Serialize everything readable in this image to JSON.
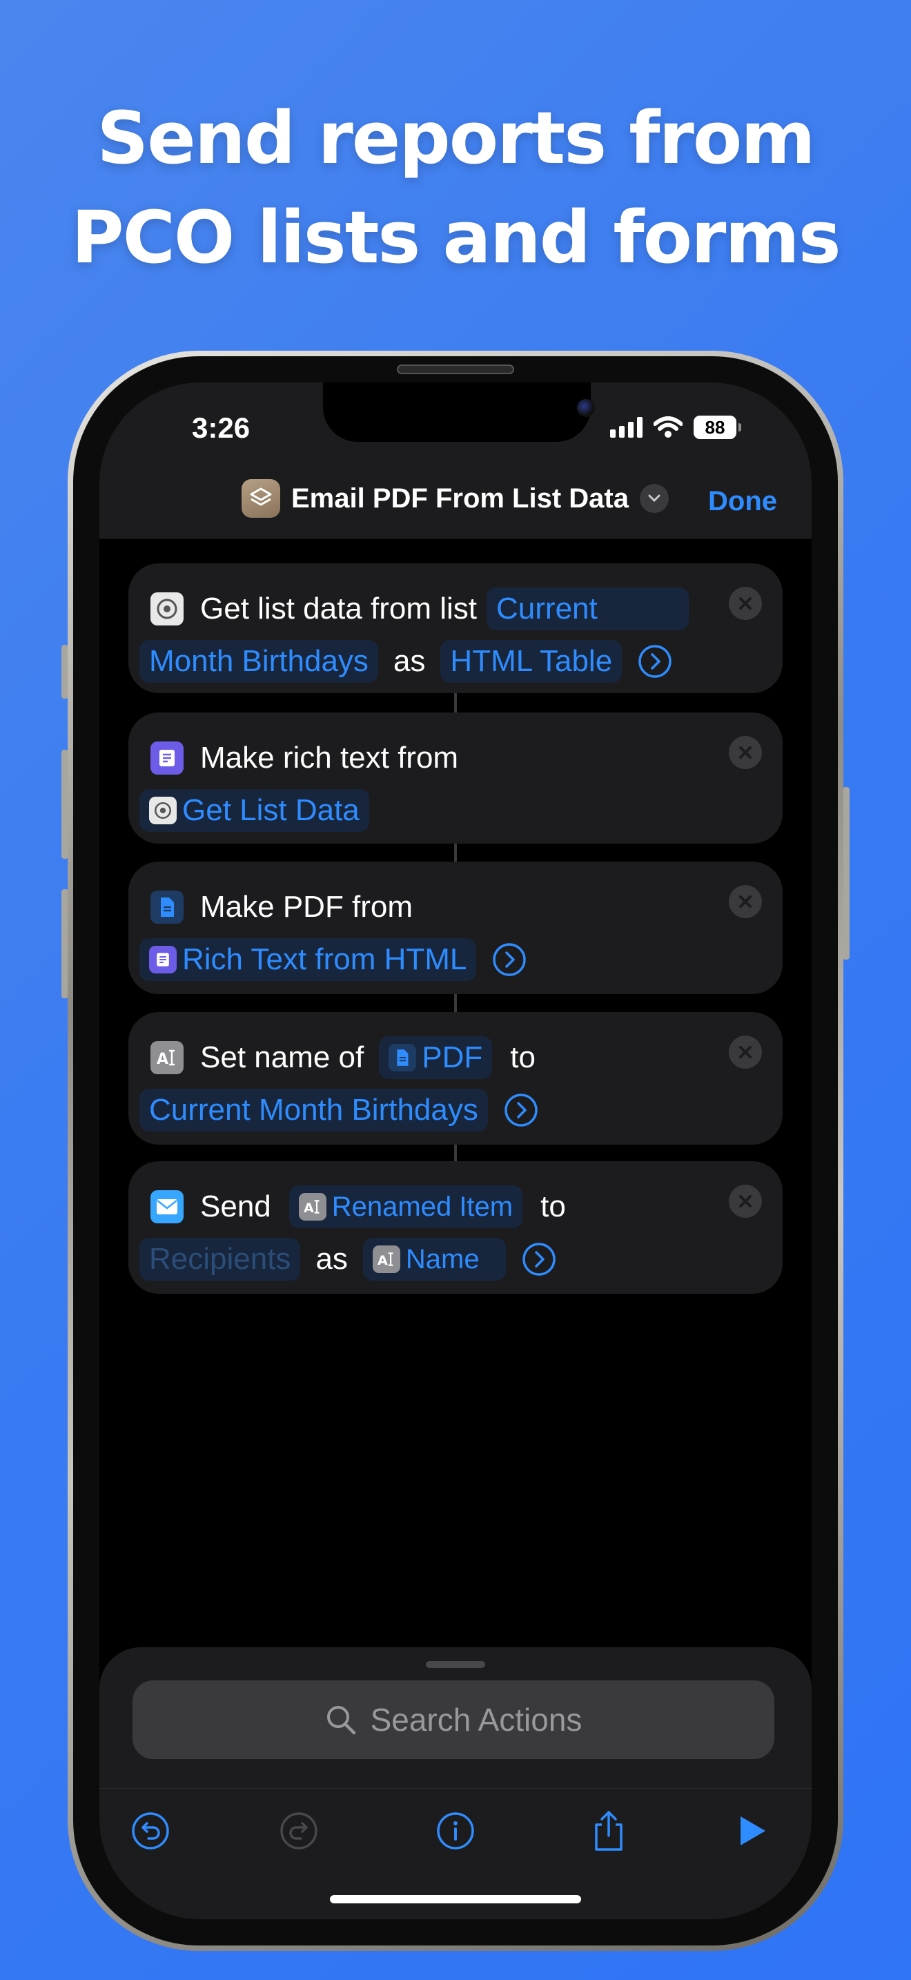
{
  "headline": {
    "line1": "Send reports from",
    "line2": "PCO lists and forms"
  },
  "status_bar": {
    "time": "3:26",
    "battery": "88"
  },
  "nav": {
    "title": "Email PDF From List Data",
    "done": "Done"
  },
  "actions": {
    "get_list": {
      "label": "Get list data from list",
      "token_list": "Current",
      "token_list_cont": "Month Birthdays",
      "as": "as",
      "token_format": "HTML Table"
    },
    "rich_text": {
      "label": "Make rich text from",
      "token_input": "Get List Data"
    },
    "make_pdf": {
      "label": "Make PDF from",
      "token_input": "Rich Text from HTML"
    },
    "set_name": {
      "label": "Set name of",
      "token_input": "PDF",
      "to": "to",
      "token_name": "Current Month Birthdays"
    },
    "send": {
      "label": "Send",
      "token_item": "Renamed Item",
      "to": "to",
      "token_recipients": "Recipients",
      "as": "as",
      "token_name": "Name"
    }
  },
  "search": {
    "placeholder": "Search Actions"
  },
  "colors": {
    "accent": "#2f8cff",
    "background_gradient_start": "#4a86ee",
    "background_gradient_end": "#2f74f5"
  }
}
